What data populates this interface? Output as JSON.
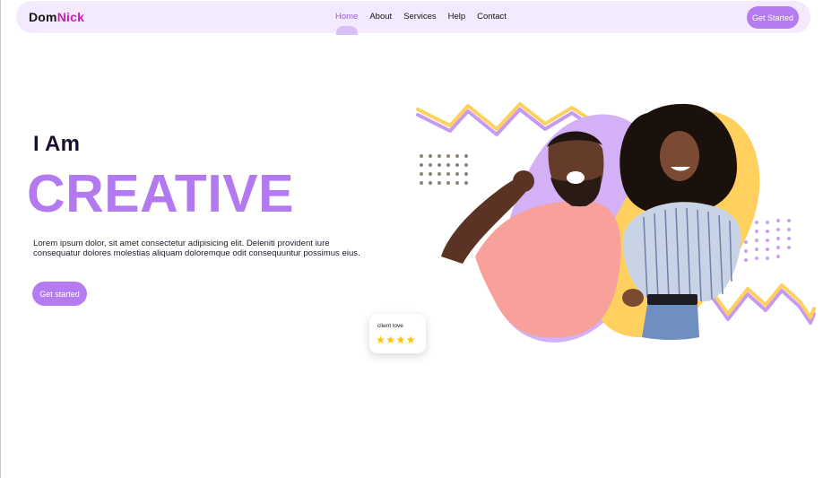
{
  "brand": {
    "part1": "Dom",
    "part2": "Nick"
  },
  "nav": {
    "items": [
      {
        "label": "Home",
        "active": true
      },
      {
        "label": "About",
        "active": false
      },
      {
        "label": "Services",
        "active": false
      },
      {
        "label": "Help",
        "active": false
      },
      {
        "label": "Contact",
        "active": false
      }
    ],
    "cta_label": "Get Started"
  },
  "hero": {
    "intro": "I Am",
    "headline": "CREATIVE",
    "description": "Lorem ipsum dolor, sit amet consectetur adipisicing elit. Deleniti provident iure consequatur dolores molestias aliquam doloremque odit consequuntur possimus eius.",
    "cta_label": "Get started"
  },
  "testimonial": {
    "label": "client love",
    "rating": 4,
    "stars": "★★★★"
  },
  "colors": {
    "accent": "#b57bf0",
    "accent_light": "#d9bff8",
    "brand_pink": "#d01fb1",
    "yellow": "#ffd05e",
    "nav_bg": "#f3eafd"
  }
}
